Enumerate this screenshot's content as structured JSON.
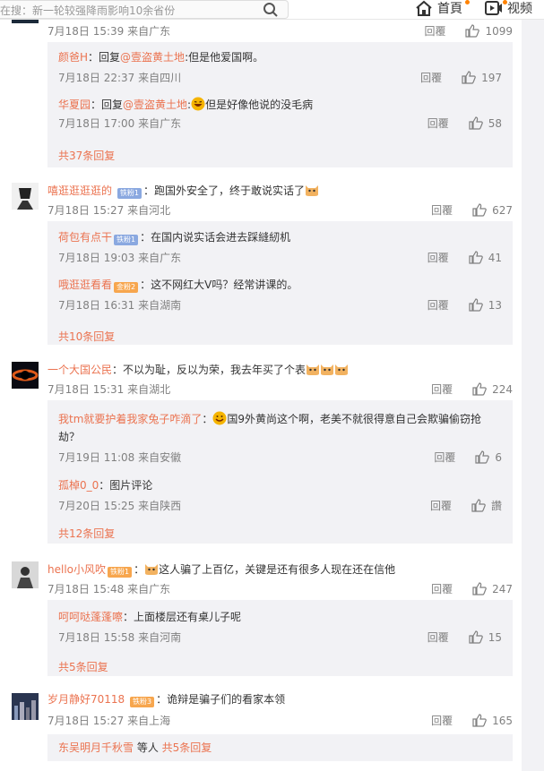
{
  "header": {
    "search_placeholder": "在搜：新一轮较强降雨影响10余省份",
    "nav_home": "首頁",
    "nav_video": "视频"
  },
  "top_comment_meta": "7月18日 15:39 来自广东",
  "top_comment_likes": "1099",
  "reply_label": "回覆",
  "block1": {
    "replies": [
      {
        "user": "颜爸H",
        "prefix": "：回复",
        "mention": "@壹盗黄土地",
        "text": ":但是他爱国啊。",
        "meta": "7月18日 22:37 来自四川",
        "likes": "197"
      },
      {
        "user": "华夏园",
        "prefix": "：回复",
        "mention": "@壹盗黄土地",
        "text": "但是好像他说的没毛病",
        "meta": "7月18日 17:00 来自广东",
        "likes": "58"
      }
    ],
    "more": "共37条回复"
  },
  "comments": [
    {
      "user": "嘻逛逛逛逛的",
      "badge": "铁粉1",
      "text": "：跑国外安全了，终于敢说实话了",
      "meta": "7月18日 15:27 来自河北",
      "likes": "627",
      "replies": [
        {
          "user": "荷包有点干",
          "badge": "铁粉1",
          "text": "：在国内说实话会进去踩縫紉机",
          "meta": "7月18日 19:03 来自广东",
          "likes": "41"
        },
        {
          "user": "哦逛逛看看",
          "badge": "金粉2",
          "text": "：这不网红大V吗？经常讲课的。",
          "meta": "7月18日 16:31 来自湖南",
          "likes": "13"
        }
      ],
      "more": "共10条回复"
    },
    {
      "user": "一个大国公民",
      "text": "：不以为耻，反以为荣，我去年买了个表",
      "meta": "7月18日 15:31 来自湖北",
      "likes": "224",
      "replies": [
        {
          "user": "我tm就要护着我家兔子咋滴了",
          "text": "国9外黄尚这个啊，老美不就很得意自己会欺骗偷窃抢",
          "text2": "劫？",
          "meta": "7月19日 11:08 来自安徽",
          "likes": "6"
        },
        {
          "user": "孤棹0_0",
          "text": "：图片评论",
          "meta": "7月20日 15:25 来自陕西",
          "likes": "讚"
        }
      ],
      "more": "共12条回复"
    },
    {
      "user": "hello小风吹",
      "badge": "铁粉1",
      "text": "这人骗了上百亿，关键是还有很多人现在还在信他",
      "meta": "7月18日 15:48 来自广东",
      "likes": "247",
      "replies": [
        {
          "user": "呵呵哒蓬蓬嚓",
          "text": "：上面楼层还有桌儿子呢",
          "meta": "7月18日 15:58 来自河南",
          "likes": "15"
        }
      ],
      "more": "共5条回复"
    },
    {
      "user": "岁月静好70118",
      "badge": "铁粉3",
      "text": "：诡辩是骗子们的看家本领",
      "meta": "7月18日 15:27 来自上海",
      "likes": "165",
      "footer_user": "东吴明月千秋雪",
      "footer_mid": " 等人 ",
      "footer_more": "共5条回复"
    }
  ],
  "colors": {
    "link": "#eb7350",
    "meta": "#808080",
    "bg": "#f2f2f5",
    "badge_blue": "#8aa8e0",
    "badge_orange": "#f7a64e"
  }
}
